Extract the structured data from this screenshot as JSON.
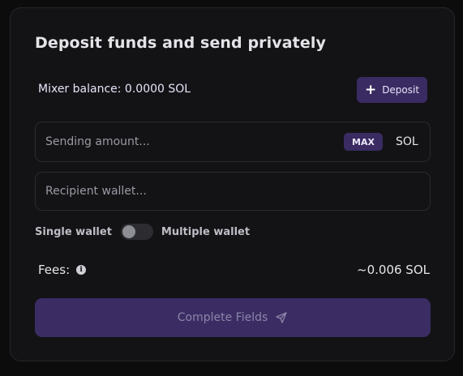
{
  "card": {
    "title": "Deposit funds and send privately",
    "balance_label": "Mixer balance: 0.0000 SOL",
    "deposit_label": "Deposit",
    "plus_symbol": "+"
  },
  "amount": {
    "placeholder": "Sending amount...",
    "value": "",
    "max_label": "MAX",
    "unit": "SOL"
  },
  "recipient": {
    "placeholder": "Recipient wallet...",
    "value": ""
  },
  "mode": {
    "single_label": "Single wallet",
    "multiple_label": "Multiple wallet",
    "toggle_on": false
  },
  "fees": {
    "label": "Fees:",
    "info_symbol": "i",
    "value": "~0.006 SOL"
  },
  "submit": {
    "label": "Complete Fields",
    "enabled": false,
    "icon": "send-icon"
  },
  "colors": {
    "accent": "#3a2b62",
    "background": "#131316"
  }
}
